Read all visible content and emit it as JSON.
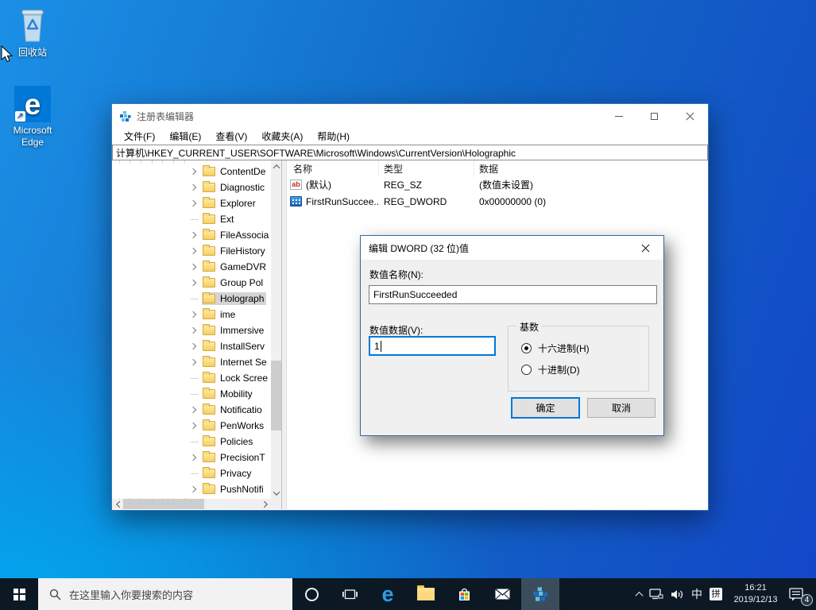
{
  "desktop": {
    "recycle_bin_label": "回收站",
    "edge_label": "Microsoft Edge"
  },
  "regedit": {
    "title": "注册表编辑器",
    "menu": [
      "文件(F)",
      "编辑(E)",
      "查看(V)",
      "收藏夹(A)",
      "帮助(H)"
    ],
    "address": "计算机\\HKEY_CURRENT_USER\\SOFTWARE\\Microsoft\\Windows\\CurrentVersion\\Holographic",
    "tree": {
      "items": [
        {
          "label": "ContentDe",
          "expandable": true
        },
        {
          "label": "Diagnostic",
          "expandable": true
        },
        {
          "label": "Explorer",
          "expandable": true
        },
        {
          "label": "Ext",
          "expandable": false
        },
        {
          "label": "FileAssocia",
          "expandable": true
        },
        {
          "label": "FileHistory",
          "expandable": true
        },
        {
          "label": "GameDVR",
          "expandable": true
        },
        {
          "label": "Group Pol",
          "expandable": true
        },
        {
          "label": "Holograph",
          "expandable": false,
          "selected": true
        },
        {
          "label": "ime",
          "expandable": true
        },
        {
          "label": "Immersive",
          "expandable": true
        },
        {
          "label": "InstallServ",
          "expandable": true
        },
        {
          "label": "Internet Se",
          "expandable": true
        },
        {
          "label": "Lock Scree",
          "expandable": false
        },
        {
          "label": "Mobility",
          "expandable": false
        },
        {
          "label": "Notificatio",
          "expandable": true
        },
        {
          "label": "PenWorks",
          "expandable": true
        },
        {
          "label": "Policies",
          "expandable": false
        },
        {
          "label": "PrecisionT",
          "expandable": true
        },
        {
          "label": "Privacy",
          "expandable": false
        },
        {
          "label": "PushNotifi",
          "expandable": true
        }
      ]
    },
    "list": {
      "columns": [
        "名称",
        "类型",
        "数据"
      ],
      "rows": [
        {
          "icon": "string-value-icon",
          "name": "(默认)",
          "type": "REG_SZ",
          "data": "(数值未设置)"
        },
        {
          "icon": "dword-value-icon",
          "name": "FirstRunSuccee...",
          "type": "REG_DWORD",
          "data": "0x00000000 (0)"
        }
      ]
    }
  },
  "dialog": {
    "title": "编辑 DWORD (32 位)值",
    "value_name_label": "数值名称(N):",
    "value_name": "FirstRunSucceeded",
    "value_data_label": "数值数据(V):",
    "value_data": "1",
    "base_label": "基数",
    "hex_option": "十六进制(H)",
    "dec_option": "十进制(D)",
    "hex_selected": true,
    "ok_label": "确定",
    "cancel_label": "取消"
  },
  "taskbar": {
    "search_placeholder": "在这里输入你要搜索的内容",
    "tray": {
      "lang_indicator": "中",
      "ime_mode": "拼",
      "time": "16:21",
      "date": "2019/12/13",
      "notification_count": "4"
    }
  },
  "colors": {
    "accent": "#0078d7",
    "desktop_top_left": "#1a92e8",
    "desktop_bottom_left": "#00aaf0",
    "desktop_right": "#1346c8",
    "taskbar": "#0c1925",
    "inactive_selection": "#d4d4d4",
    "folder": "#f7cf5e"
  }
}
